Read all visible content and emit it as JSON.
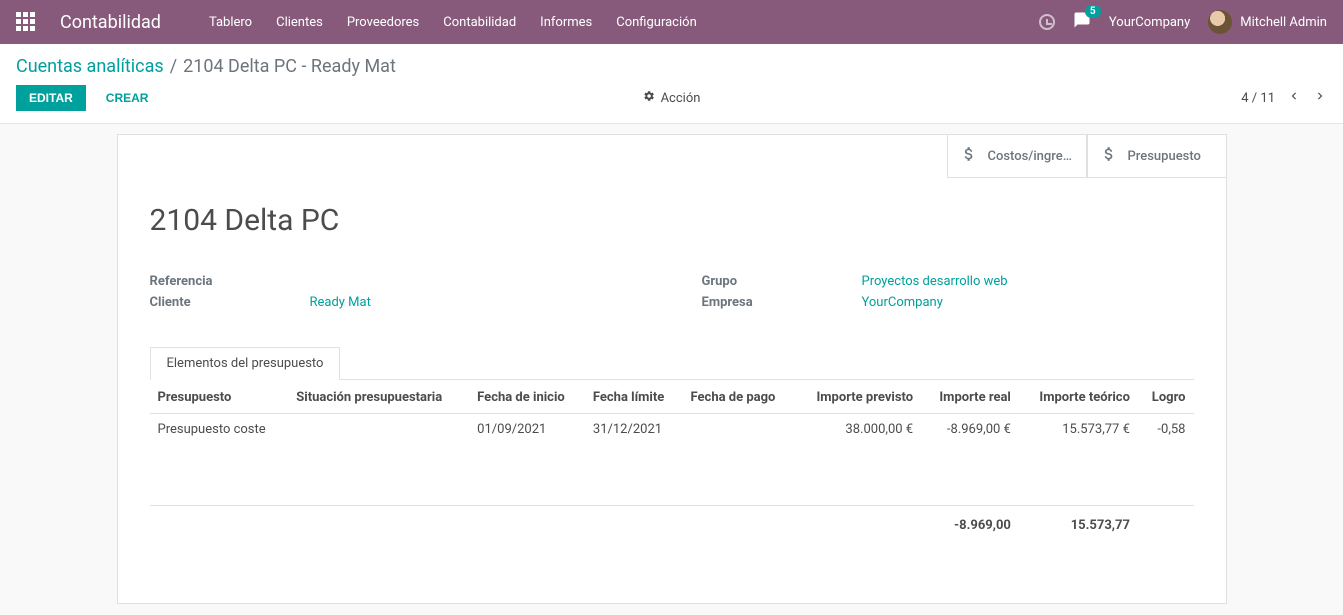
{
  "navbar": {
    "brand": "Contabilidad",
    "items": [
      "Tablero",
      "Clientes",
      "Proveedores",
      "Contabilidad",
      "Informes",
      "Configuración"
    ],
    "badge": "5",
    "company": "YourCompany",
    "user": "Mitchell Admin"
  },
  "breadcrumb": {
    "root": "Cuentas analíticas",
    "current": "2104 Delta PC - Ready Mat"
  },
  "actions": {
    "edit": "Editar",
    "create": "Crear",
    "action": "Acción",
    "pager": "4 / 11"
  },
  "stat_buttons": {
    "costs": "Costos/ingre…",
    "budget": "Presupuesto"
  },
  "record": {
    "title": "2104 Delta PC",
    "labels": {
      "reference": "Referencia",
      "customer": "Cliente",
      "group": "Grupo",
      "company": "Empresa"
    },
    "values": {
      "reference": "",
      "customer": "Ready Mat",
      "group": "Proyectos desarrollo web",
      "company": "YourCompany"
    }
  },
  "tab": {
    "label": "Elementos del presupuesto"
  },
  "table": {
    "headers": {
      "budget": "Presupuesto",
      "situation": "Situación presupuestaria",
      "start": "Fecha de inicio",
      "end": "Fecha límite",
      "paid": "Fecha de pago",
      "planned": "Importe previsto",
      "real": "Importe real",
      "theoretical": "Importe teórico",
      "achieve": "Logro"
    },
    "row": {
      "budget": "Presupuesto coste",
      "situation": "",
      "start": "01/09/2021",
      "end": "31/12/2021",
      "paid": "",
      "planned": "38.000,00 €",
      "real": "-8.969,00 €",
      "theoretical": "15.573,77 €",
      "achieve": "-0,58"
    },
    "totals": {
      "real": "-8.969,00",
      "theoretical": "15.573,77"
    }
  }
}
